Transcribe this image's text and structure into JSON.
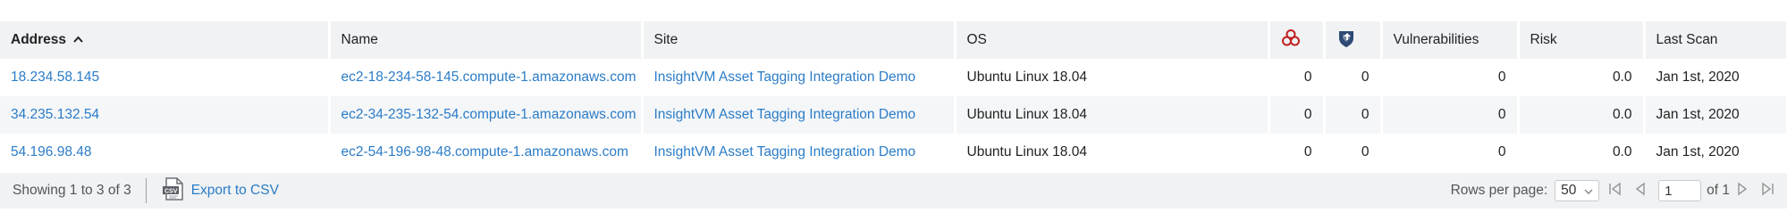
{
  "columns": {
    "address": "Address",
    "name": "Name",
    "site": "Site",
    "os": "OS",
    "vulnerabilities": "Vulnerabilities",
    "risk": "Risk",
    "last_scan": "Last Scan"
  },
  "rows": [
    {
      "address": "18.234.58.145",
      "name": "ec2-18-234-58-145.compute-1.amazonaws.com",
      "site": "InsightVM Asset Tagging Integration Demo",
      "os": "Ubuntu Linux 18.04",
      "malware": "0",
      "exploits": "0",
      "vulnerabilities": "0",
      "risk": "0.0",
      "last_scan": "Jan 1st, 2020"
    },
    {
      "address": "34.235.132.54",
      "name": "ec2-34-235-132-54.compute-1.amazonaws.com",
      "site": "InsightVM Asset Tagging Integration Demo",
      "os": "Ubuntu Linux 18.04",
      "malware": "0",
      "exploits": "0",
      "vulnerabilities": "0",
      "risk": "0.0",
      "last_scan": "Jan 1st, 2020"
    },
    {
      "address": "54.196.98.48",
      "name": "ec2-54-196-98-48.compute-1.amazonaws.com",
      "site": "InsightVM Asset Tagging Integration Demo",
      "os": "Ubuntu Linux 18.04",
      "malware": "0",
      "exploits": "0",
      "vulnerabilities": "0",
      "risk": "0.0",
      "last_scan": "Jan 1st, 2020"
    }
  ],
  "footer": {
    "showing": "Showing 1 to 3 of 3",
    "export_label": "Export to CSV",
    "rows_per_page_label": "Rows per page:",
    "rows_per_page_value": "50",
    "page_value": "1",
    "of_pages": "of 1"
  },
  "icons": {
    "sort": "sort-ascending-icon",
    "malware": "biohazard-icon",
    "exploit": "exploit-shield-icon",
    "export": "csv-file-icon"
  },
  "colors": {
    "link": "#2b7cc7",
    "header_bg": "#f0f2f4",
    "biohazard": "#c0201e",
    "exploit": "#2e4a75"
  }
}
